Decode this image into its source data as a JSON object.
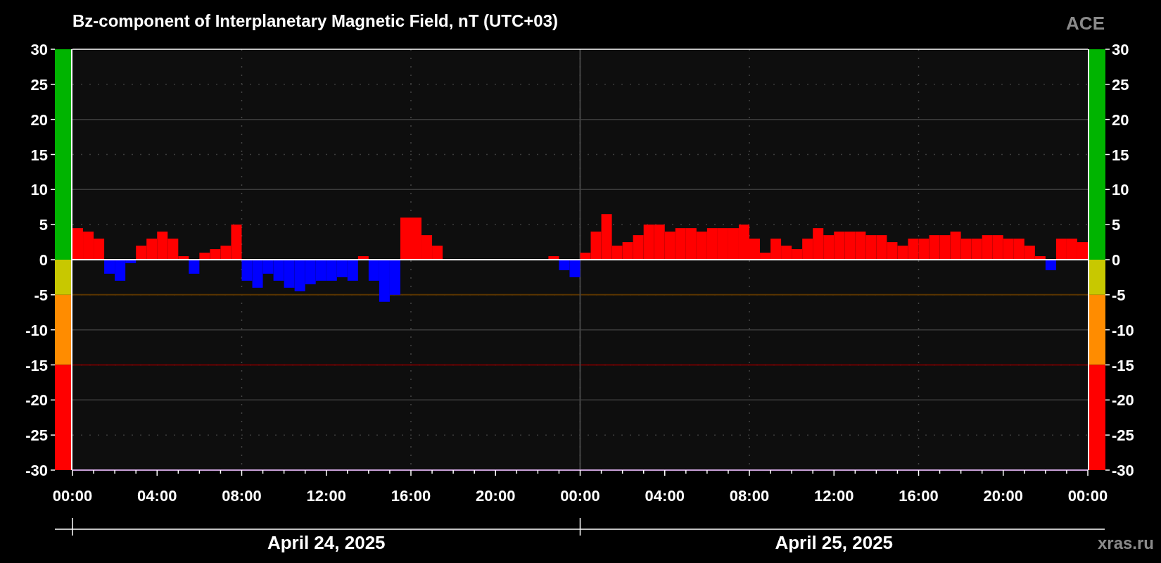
{
  "chart": {
    "title": "Bz-component of Interplanetary Magnetic Field, nT (UTC+03)",
    "source_label": "ACE",
    "chart_data": {
      "type": "bar",
      "grid": true,
      "x": [
        "2025-04-24T00:00",
        "2025-04-24T00:30",
        "2025-04-24T01:00",
        "2025-04-24T01:30",
        "2025-04-24T02:00",
        "2025-04-24T02:30",
        "2025-04-24T03:00",
        "2025-04-24T03:30",
        "2025-04-24T04:00",
        "2025-04-24T04:30",
        "2025-04-24T05:00",
        "2025-04-24T05:30",
        "2025-04-24T06:00",
        "2025-04-24T06:30",
        "2025-04-24T07:00",
        "2025-04-24T07:30",
        "2025-04-24T08:00",
        "2025-04-24T08:30",
        "2025-04-24T09:00",
        "2025-04-24T09:30",
        "2025-04-24T10:00",
        "2025-04-24T10:30",
        "2025-04-24T11:00",
        "2025-04-24T11:30",
        "2025-04-24T12:00",
        "2025-04-24T12:30",
        "2025-04-24T13:00",
        "2025-04-24T13:30",
        "2025-04-24T14:00",
        "2025-04-24T14:30",
        "2025-04-24T15:00",
        "2025-04-24T15:30",
        "2025-04-24T16:00",
        "2025-04-24T16:30",
        "2025-04-24T17:00",
        "2025-04-24T17:30",
        "2025-04-24T18:00",
        "2025-04-24T18:30",
        "2025-04-24T19:00",
        "2025-04-24T19:30",
        "2025-04-24T20:00",
        "2025-04-24T20:30",
        "2025-04-24T21:00",
        "2025-04-24T21:30",
        "2025-04-24T22:00",
        "2025-04-24T22:30",
        "2025-04-24T23:00",
        "2025-04-24T23:30",
        "2025-04-25T00:00",
        "2025-04-25T00:30",
        "2025-04-25T01:00",
        "2025-04-25T01:30",
        "2025-04-25T02:00",
        "2025-04-25T02:30",
        "2025-04-25T03:00",
        "2025-04-25T03:30",
        "2025-04-25T04:00",
        "2025-04-25T04:30",
        "2025-04-25T05:00",
        "2025-04-25T05:30",
        "2025-04-25T06:00",
        "2025-04-25T06:30",
        "2025-04-25T07:00",
        "2025-04-25T07:30",
        "2025-04-25T08:00",
        "2025-04-25T08:30",
        "2025-04-25T09:00",
        "2025-04-25T09:30",
        "2025-04-25T10:00",
        "2025-04-25T10:30",
        "2025-04-25T11:00",
        "2025-04-25T11:30",
        "2025-04-25T12:00",
        "2025-04-25T12:30",
        "2025-04-25T13:00",
        "2025-04-25T13:30",
        "2025-04-25T14:00",
        "2025-04-25T14:30",
        "2025-04-25T15:00",
        "2025-04-25T15:30",
        "2025-04-25T16:00",
        "2025-04-25T16:30",
        "2025-04-25T17:00",
        "2025-04-25T17:30",
        "2025-04-25T18:00",
        "2025-04-25T18:30",
        "2025-04-25T19:00",
        "2025-04-25T19:30",
        "2025-04-25T20:00",
        "2025-04-25T20:30",
        "2025-04-25T21:00",
        "2025-04-25T21:30",
        "2025-04-25T22:00",
        "2025-04-25T22:30",
        "2025-04-25T23:00",
        "2025-04-25T23:30"
      ],
      "series": [
        {
          "color": "#ff0000",
          "values": [
            4.5,
            4,
            3,
            null,
            null,
            null,
            2,
            3,
            4,
            3,
            0.5,
            null,
            1,
            1.5,
            2,
            5,
            null,
            null,
            null,
            null,
            null,
            null,
            null,
            null,
            null,
            null,
            null,
            0.5,
            null,
            null,
            null,
            6,
            6,
            3.5,
            2,
            null,
            null,
            null,
            null,
            null,
            null,
            null,
            null,
            null,
            null,
            0.5,
            null,
            null,
            1,
            4,
            6.5,
            2,
            2.5,
            3.5,
            5,
            5,
            4,
            4.5,
            4.5,
            4,
            4.5,
            4.5,
            4.5,
            5,
            3,
            1,
            3,
            2,
            1.5,
            3,
            4.5,
            3.5,
            4,
            4,
            4,
            3.5,
            3.5,
            2.5,
            2,
            3,
            3,
            3.5,
            3.5,
            4,
            3,
            3,
            3.5,
            3.5,
            3,
            3,
            2,
            0.5,
            null,
            3,
            3,
            2.5
          ]
        },
        {
          "color": "#0000ff",
          "values": [
            null,
            null,
            null,
            -2,
            -3,
            -0.5,
            null,
            null,
            null,
            null,
            null,
            -2,
            null,
            null,
            null,
            null,
            -3,
            -4,
            -2,
            -3,
            -4,
            -4.5,
            -3.5,
            -3,
            -3,
            -2.5,
            -3,
            null,
            -3,
            -6,
            -5,
            null,
            null,
            null,
            null,
            null,
            null,
            null,
            null,
            null,
            null,
            null,
            null,
            null,
            null,
            null,
            -1.5,
            -2.5,
            null,
            null,
            null,
            null,
            null,
            null,
            null,
            null,
            null,
            null,
            null,
            null,
            null,
            null,
            null,
            null,
            null,
            null,
            null,
            null,
            null,
            null,
            null,
            null,
            null,
            null,
            null,
            null,
            null,
            null,
            null,
            null,
            null,
            null,
            null,
            null,
            null,
            null,
            null,
            null,
            null,
            null,
            null,
            null,
            -1.5,
            null,
            null,
            null
          ]
        }
      ],
      "xlim": [
        "2025-04-24T00:00",
        "2025-04-26T00:00"
      ],
      "ylim": [
        -30,
        30
      ],
      "xticks": [
        {
          "value": "2025-04-24T00:00",
          "label": "00:00"
        },
        {
          "value": "2025-04-24T04:00",
          "label": "04:00"
        },
        {
          "value": "2025-04-24T08:00",
          "label": "08:00"
        },
        {
          "value": "2025-04-24T12:00",
          "label": "12:00"
        },
        {
          "value": "2025-04-24T16:00",
          "label": "16:00"
        },
        {
          "value": "2025-04-24T20:00",
          "label": "20:00"
        },
        {
          "value": "2025-04-25T00:00",
          "label": "00:00"
        },
        {
          "value": "2025-04-25T04:00",
          "label": "04:00"
        },
        {
          "value": "2025-04-25T08:00",
          "label": "08:00"
        },
        {
          "value": "2025-04-25T12:00",
          "label": "12:00"
        },
        {
          "value": "2025-04-25T16:00",
          "label": "16:00"
        },
        {
          "value": "2025-04-25T20:00",
          "label": "20:00"
        },
        {
          "value": "2025-04-26T00:00",
          "label": "00:00"
        }
      ],
      "yticks": [
        30,
        25,
        20,
        15,
        10,
        5,
        0,
        -5,
        -10,
        -15,
        -20,
        -25,
        -30
      ],
      "y2lim": [
        -30,
        30
      ],
      "y2ticks": [
        30,
        25,
        20,
        15,
        10,
        5,
        0,
        -5,
        -10,
        -15,
        -20,
        -25,
        -30
      ],
      "ref_lines": [
        {
          "axis": "y",
          "value": -5,
          "color": "#5a3400"
        },
        {
          "axis": "y",
          "value": -15,
          "color": "#6a0000"
        },
        {
          "axis": "x",
          "value": "2025-04-25T00:00",
          "color": "#444444"
        }
      ]
    },
    "date_labels": [
      "April 24, 2025",
      "April 25, 2025"
    ],
    "credit": "xras.ru"
  }
}
